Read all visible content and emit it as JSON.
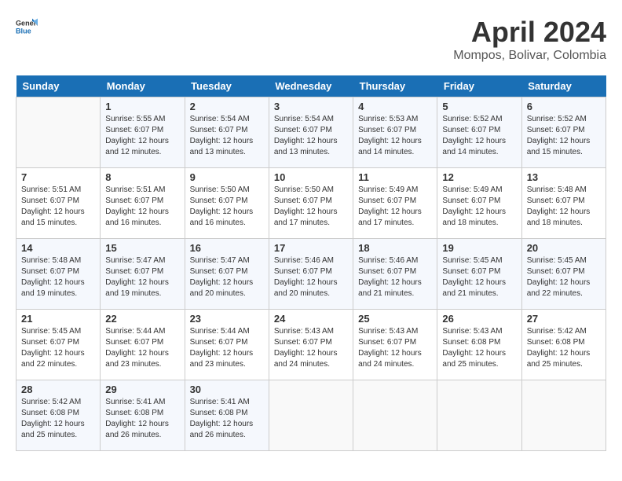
{
  "header": {
    "logo_line1": "General",
    "logo_line2": "Blue",
    "title": "April 2024",
    "subtitle": "Mompos, Bolivar, Colombia"
  },
  "columns": [
    "Sunday",
    "Monday",
    "Tuesday",
    "Wednesday",
    "Thursday",
    "Friday",
    "Saturday"
  ],
  "weeks": [
    [
      {
        "day": "",
        "sunrise": "",
        "sunset": "",
        "daylight": ""
      },
      {
        "day": "1",
        "sunrise": "5:55 AM",
        "sunset": "6:07 PM",
        "daylight": "12 hours and 12 minutes."
      },
      {
        "day": "2",
        "sunrise": "5:54 AM",
        "sunset": "6:07 PM",
        "daylight": "12 hours and 13 minutes."
      },
      {
        "day": "3",
        "sunrise": "5:54 AM",
        "sunset": "6:07 PM",
        "daylight": "12 hours and 13 minutes."
      },
      {
        "day": "4",
        "sunrise": "5:53 AM",
        "sunset": "6:07 PM",
        "daylight": "12 hours and 14 minutes."
      },
      {
        "day": "5",
        "sunrise": "5:52 AM",
        "sunset": "6:07 PM",
        "daylight": "12 hours and 14 minutes."
      },
      {
        "day": "6",
        "sunrise": "5:52 AM",
        "sunset": "6:07 PM",
        "daylight": "12 hours and 15 minutes."
      }
    ],
    [
      {
        "day": "7",
        "sunrise": "5:51 AM",
        "sunset": "6:07 PM",
        "daylight": "12 hours and 15 minutes."
      },
      {
        "day": "8",
        "sunrise": "5:51 AM",
        "sunset": "6:07 PM",
        "daylight": "12 hours and 16 minutes."
      },
      {
        "day": "9",
        "sunrise": "5:50 AM",
        "sunset": "6:07 PM",
        "daylight": "12 hours and 16 minutes."
      },
      {
        "day": "10",
        "sunrise": "5:50 AM",
        "sunset": "6:07 PM",
        "daylight": "12 hours and 17 minutes."
      },
      {
        "day": "11",
        "sunrise": "5:49 AM",
        "sunset": "6:07 PM",
        "daylight": "12 hours and 17 minutes."
      },
      {
        "day": "12",
        "sunrise": "5:49 AM",
        "sunset": "6:07 PM",
        "daylight": "12 hours and 18 minutes."
      },
      {
        "day": "13",
        "sunrise": "5:48 AM",
        "sunset": "6:07 PM",
        "daylight": "12 hours and 18 minutes."
      }
    ],
    [
      {
        "day": "14",
        "sunrise": "5:48 AM",
        "sunset": "6:07 PM",
        "daylight": "12 hours and 19 minutes."
      },
      {
        "day": "15",
        "sunrise": "5:47 AM",
        "sunset": "6:07 PM",
        "daylight": "12 hours and 19 minutes."
      },
      {
        "day": "16",
        "sunrise": "5:47 AM",
        "sunset": "6:07 PM",
        "daylight": "12 hours and 20 minutes."
      },
      {
        "day": "17",
        "sunrise": "5:46 AM",
        "sunset": "6:07 PM",
        "daylight": "12 hours and 20 minutes."
      },
      {
        "day": "18",
        "sunrise": "5:46 AM",
        "sunset": "6:07 PM",
        "daylight": "12 hours and 21 minutes."
      },
      {
        "day": "19",
        "sunrise": "5:45 AM",
        "sunset": "6:07 PM",
        "daylight": "12 hours and 21 minutes."
      },
      {
        "day": "20",
        "sunrise": "5:45 AM",
        "sunset": "6:07 PM",
        "daylight": "12 hours and 22 minutes."
      }
    ],
    [
      {
        "day": "21",
        "sunrise": "5:45 AM",
        "sunset": "6:07 PM",
        "daylight": "12 hours and 22 minutes."
      },
      {
        "day": "22",
        "sunrise": "5:44 AM",
        "sunset": "6:07 PM",
        "daylight": "12 hours and 23 minutes."
      },
      {
        "day": "23",
        "sunrise": "5:44 AM",
        "sunset": "6:07 PM",
        "daylight": "12 hours and 23 minutes."
      },
      {
        "day": "24",
        "sunrise": "5:43 AM",
        "sunset": "6:07 PM",
        "daylight": "12 hours and 24 minutes."
      },
      {
        "day": "25",
        "sunrise": "5:43 AM",
        "sunset": "6:07 PM",
        "daylight": "12 hours and 24 minutes."
      },
      {
        "day": "26",
        "sunrise": "5:43 AM",
        "sunset": "6:08 PM",
        "daylight": "12 hours and 25 minutes."
      },
      {
        "day": "27",
        "sunrise": "5:42 AM",
        "sunset": "6:08 PM",
        "daylight": "12 hours and 25 minutes."
      }
    ],
    [
      {
        "day": "28",
        "sunrise": "5:42 AM",
        "sunset": "6:08 PM",
        "daylight": "12 hours and 25 minutes."
      },
      {
        "day": "29",
        "sunrise": "5:41 AM",
        "sunset": "6:08 PM",
        "daylight": "12 hours and 26 minutes."
      },
      {
        "day": "30",
        "sunrise": "5:41 AM",
        "sunset": "6:08 PM",
        "daylight": "12 hours and 26 minutes."
      },
      {
        "day": "",
        "sunrise": "",
        "sunset": "",
        "daylight": ""
      },
      {
        "day": "",
        "sunrise": "",
        "sunset": "",
        "daylight": ""
      },
      {
        "day": "",
        "sunrise": "",
        "sunset": "",
        "daylight": ""
      },
      {
        "day": "",
        "sunrise": "",
        "sunset": "",
        "daylight": ""
      }
    ]
  ]
}
